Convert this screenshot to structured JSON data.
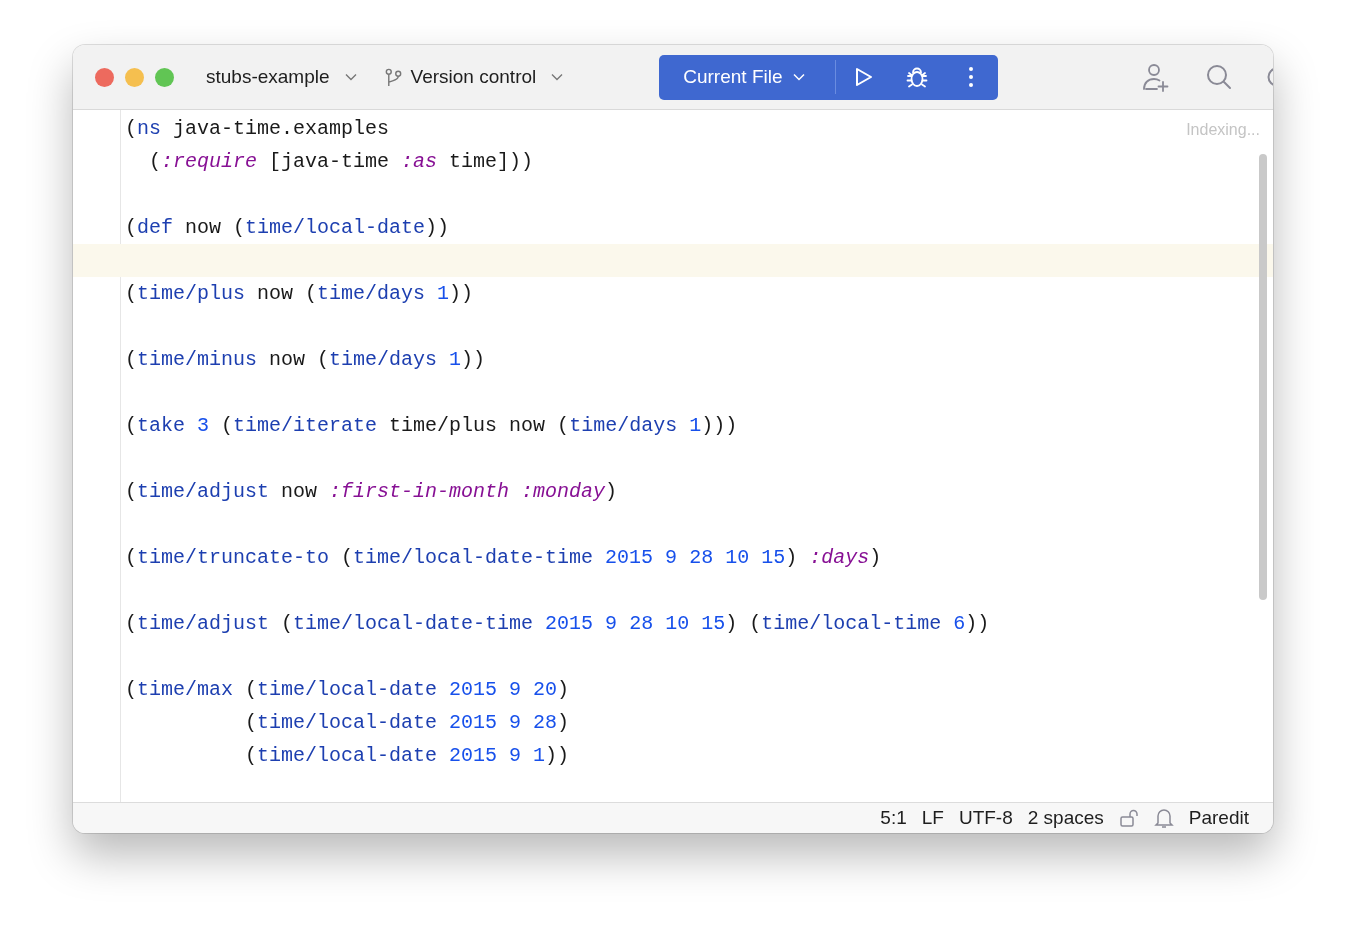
{
  "window": {
    "project": "stubs-example",
    "vcs": "Version control"
  },
  "run_widget": {
    "configuration": "Current File"
  },
  "editor": {
    "status": "Indexing...",
    "lines": [
      {
        "current": false,
        "tokens": [
          {
            "kind": "plain",
            "text": "("
          },
          {
            "kind": "fn",
            "text": "ns"
          },
          {
            "kind": "plain",
            "text": " java-time.examples"
          }
        ]
      },
      {
        "current": false,
        "tokens": [
          {
            "kind": "plain",
            "text": "  ("
          },
          {
            "kind": "kw",
            "text": ":require"
          },
          {
            "kind": "plain",
            "text": " [java-time "
          },
          {
            "kind": "kw",
            "text": ":as"
          },
          {
            "kind": "plain",
            "text": " time]))"
          }
        ]
      },
      {
        "current": false
      },
      {
        "current": false,
        "tokens": [
          {
            "kind": "plain",
            "text": "("
          },
          {
            "kind": "fn",
            "text": "def"
          },
          {
            "kind": "plain",
            "text": " now ("
          },
          {
            "kind": "fn",
            "text": "time/local-date"
          },
          {
            "kind": "plain",
            "text": "))"
          }
        ]
      },
      {
        "current": true
      },
      {
        "current": false,
        "tokens": [
          {
            "kind": "plain",
            "text": "("
          },
          {
            "kind": "fn",
            "text": "time/plus"
          },
          {
            "kind": "plain",
            "text": " now ("
          },
          {
            "kind": "fn",
            "text": "time/days"
          },
          {
            "kind": "num",
            "text": " 1"
          },
          {
            "kind": "plain",
            "text": "))"
          }
        ]
      },
      {
        "current": false
      },
      {
        "current": false,
        "tokens": [
          {
            "kind": "plain",
            "text": "("
          },
          {
            "kind": "fn",
            "text": "time/minus"
          },
          {
            "kind": "plain",
            "text": " now ("
          },
          {
            "kind": "fn",
            "text": "time/days"
          },
          {
            "kind": "num",
            "text": " 1"
          },
          {
            "kind": "plain",
            "text": "))"
          }
        ]
      },
      {
        "current": false
      },
      {
        "current": false,
        "tokens": [
          {
            "kind": "plain",
            "text": "("
          },
          {
            "kind": "fn",
            "text": "take"
          },
          {
            "kind": "num",
            "text": " 3"
          },
          {
            "kind": "plain",
            "text": " ("
          },
          {
            "kind": "fn",
            "text": "time/iterate"
          },
          {
            "kind": "plain",
            "text": " time/plus now ("
          },
          {
            "kind": "fn",
            "text": "time/days"
          },
          {
            "kind": "num",
            "text": " 1"
          },
          {
            "kind": "plain",
            "text": ")))"
          }
        ]
      },
      {
        "current": false
      },
      {
        "current": false,
        "tokens": [
          {
            "kind": "plain",
            "text": "("
          },
          {
            "kind": "fn",
            "text": "time/adjust"
          },
          {
            "kind": "plain",
            "text": " now "
          },
          {
            "kind": "kw",
            "text": ":first-in-month :monday"
          },
          {
            "kind": "plain",
            "text": ")"
          }
        ]
      },
      {
        "current": false
      },
      {
        "current": false,
        "tokens": [
          {
            "kind": "plain",
            "text": "("
          },
          {
            "kind": "fn",
            "text": "time/truncate-to"
          },
          {
            "kind": "plain",
            "text": " ("
          },
          {
            "kind": "fn",
            "text": "time/local-date-time"
          },
          {
            "kind": "num",
            "text": " 2015 9 28 10 15"
          },
          {
            "kind": "plain",
            "text": ") "
          },
          {
            "kind": "kw",
            "text": ":days"
          },
          {
            "kind": "plain",
            "text": ")"
          }
        ]
      },
      {
        "current": false
      },
      {
        "current": false,
        "tokens": [
          {
            "kind": "plain",
            "text": "("
          },
          {
            "kind": "fn",
            "text": "time/adjust"
          },
          {
            "kind": "plain",
            "text": " ("
          },
          {
            "kind": "fn",
            "text": "time/local-date-time"
          },
          {
            "kind": "num",
            "text": " 2015 9 28 10 15"
          },
          {
            "kind": "plain",
            "text": ") ("
          },
          {
            "kind": "fn",
            "text": "time/local-time"
          },
          {
            "kind": "num",
            "text": " 6"
          },
          {
            "kind": "plain",
            "text": "))"
          }
        ]
      },
      {
        "current": false
      },
      {
        "current": false,
        "tokens": [
          {
            "kind": "plain",
            "text": "("
          },
          {
            "kind": "fn",
            "text": "time/max"
          },
          {
            "kind": "plain",
            "text": " ("
          },
          {
            "kind": "fn",
            "text": "time/local-date"
          },
          {
            "kind": "num",
            "text": " 2015 9 20"
          },
          {
            "kind": "plain",
            "text": ")"
          }
        ]
      },
      {
        "current": false,
        "tokens": [
          {
            "kind": "plain",
            "text": "          ("
          },
          {
            "kind": "fn",
            "text": "time/local-date"
          },
          {
            "kind": "num",
            "text": " 2015 9 28"
          },
          {
            "kind": "plain",
            "text": ")"
          }
        ]
      },
      {
        "current": false,
        "tokens": [
          {
            "kind": "plain",
            "text": "          ("
          },
          {
            "kind": "fn",
            "text": "time/local-date"
          },
          {
            "kind": "num",
            "text": " 2015 9 1"
          },
          {
            "kind": "plain",
            "text": "))"
          }
        ]
      }
    ]
  },
  "status_bar": {
    "position": "5:1",
    "line_separator": "LF",
    "encoding": "UTF-8",
    "indent": "2 spaces",
    "mode": "Paredit"
  }
}
